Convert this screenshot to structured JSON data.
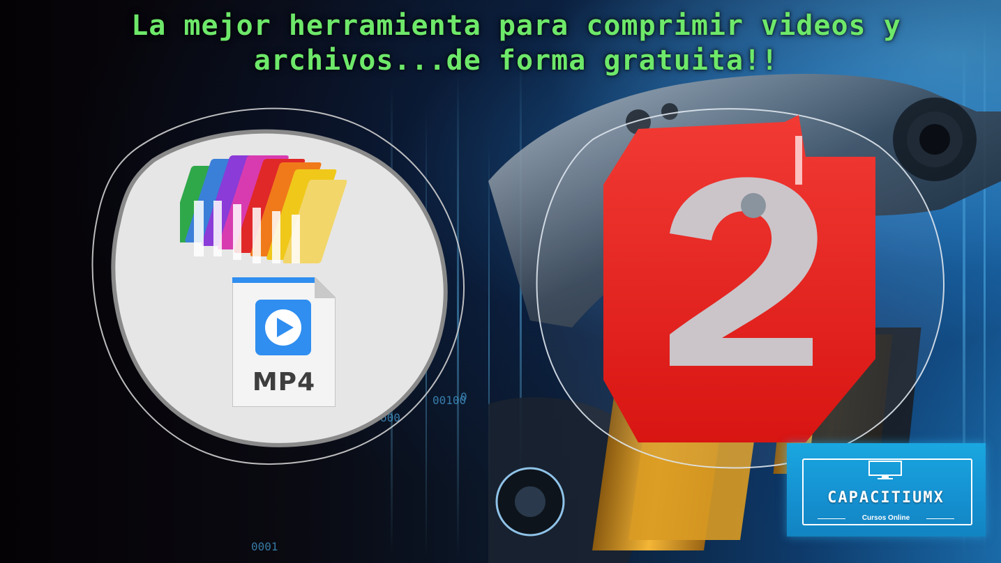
{
  "headline": {
    "line1": "La mejor herramienta para comprimir videos y",
    "line2": "archivos...de forma gratuita!!",
    "color": "#6ee86a"
  },
  "left_panel": {
    "folders_icon": "colorful-folders-icon",
    "file_icon": "mp4-file-icon",
    "file_label": "MP4",
    "play_icon": "play-icon"
  },
  "right_panel": {
    "logo_icon": "red-2-logo-icon",
    "logo_color": "#e8201c"
  },
  "badge": {
    "name": "CAPACITIUMX",
    "subtitle": "Cursos Online",
    "icon": "monitor-icon",
    "color": "#1aa7e0"
  }
}
